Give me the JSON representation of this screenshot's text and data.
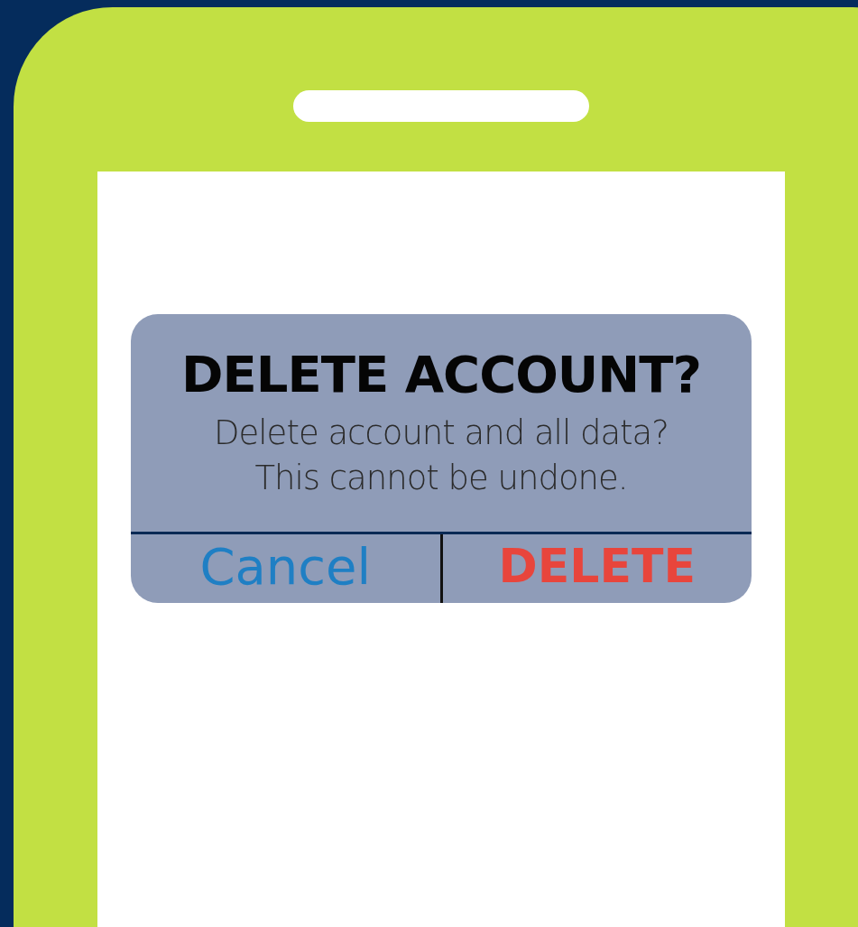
{
  "dialog": {
    "title": "DELETE ACCOUNT?",
    "message_lines": [
      "Delete account and all data?",
      "This cannot be undone."
    ],
    "buttons": [
      {
        "label": "Cancel",
        "kind": "cancel"
      },
      {
        "label": "DELETE",
        "kind": "destructive"
      }
    ]
  }
}
